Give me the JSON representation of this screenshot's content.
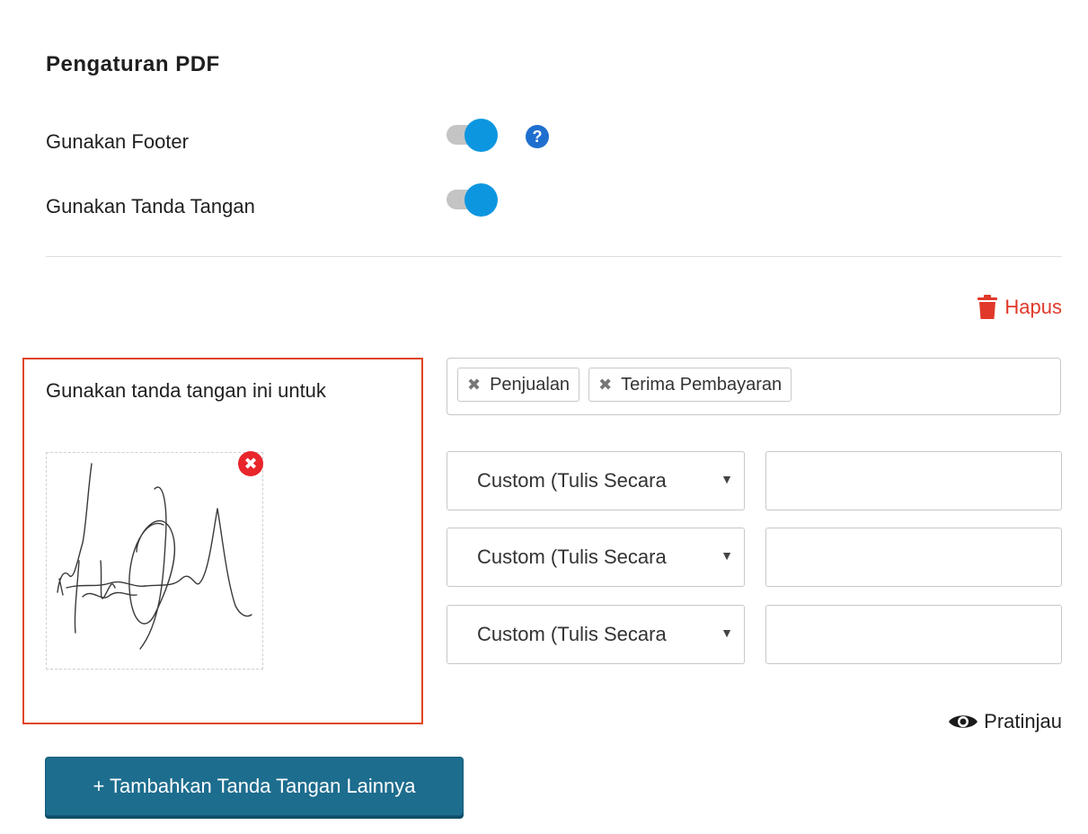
{
  "section_title": "Pengaturan PDF",
  "settings": {
    "footer_label": "Gunakan Footer",
    "footer_enabled": true,
    "signature_label": "Gunakan Tanda Tangan",
    "signature_enabled": true,
    "help_glyph": "?"
  },
  "delete_label": "Hapus",
  "signature_block": {
    "usage_label": "Gunakan tanda tangan ini untuk",
    "remove_glyph": "✖",
    "tags": [
      {
        "label": "Penjualan",
        "remove_glyph": "✖"
      },
      {
        "label": "Terima Pembayaran",
        "remove_glyph": "✖"
      }
    ],
    "rows": [
      {
        "select_value": "Custom (Tulis Secara",
        "input_value": ""
      },
      {
        "select_value": "Custom (Tulis Secara",
        "input_value": ""
      },
      {
        "select_value": "Custom (Tulis Secara",
        "input_value": ""
      }
    ],
    "caret_glyph": "▼"
  },
  "preview_label": "Pratinjau",
  "add_button_label": "+ Tambahkan Tanda Tangan Lainnya",
  "colors": {
    "toggle_on": "#0d96e0",
    "danger": "#e0392b",
    "highlight_border": "#e0451f",
    "primary_button": "#1d6d8e"
  },
  "icons": {
    "help": "question-circle-icon",
    "delete": "trash-icon",
    "remove_signature": "times-circle-icon",
    "preview": "eye-icon"
  }
}
